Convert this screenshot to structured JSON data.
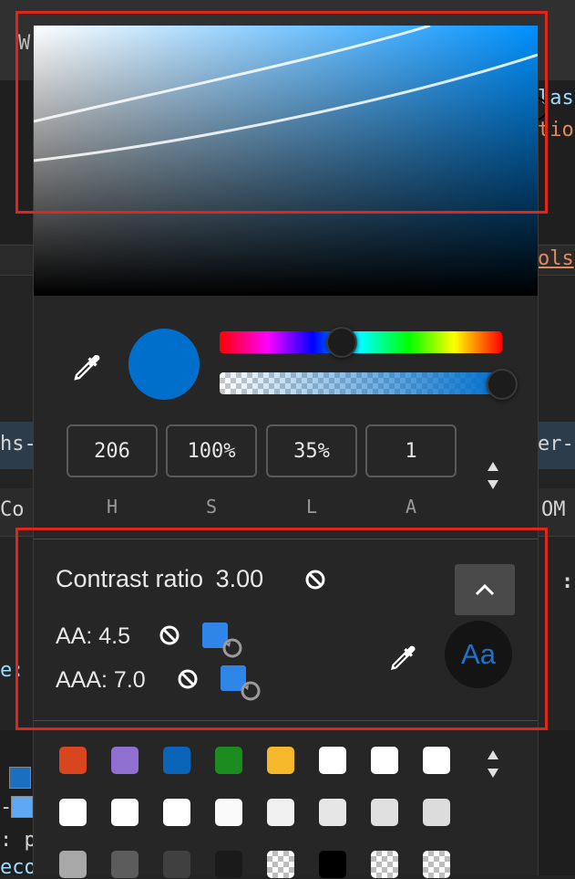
{
  "background": {
    "code_fragments": [
      {
        "id": "w",
        "text": "W"
      },
      {
        "id": "las",
        "text": "las"
      },
      {
        "id": "tio",
        "text": "tio"
      },
      {
        "id": "ols",
        "text": "ols"
      },
      {
        "id": "hs",
        "text": "hs-"
      },
      {
        "id": "erc",
        "text": "er-c"
      },
      {
        "id": "co",
        "text": "Co"
      },
      {
        "id": "om",
        "text": "OM"
      },
      {
        "id": "colon",
        "text": ":"
      },
      {
        "id": "ep",
        "text": "e:"
      },
      {
        "id": "dash",
        "text": "-"
      },
      {
        "id": "p",
        "text": ": p"
      },
      {
        "id": "eco",
        "text": "eco"
      }
    ]
  },
  "color_picker": {
    "current_color": "#006fcc",
    "format_fields": [
      {
        "label": "H",
        "value": "206"
      },
      {
        "label": "S",
        "value": "100%"
      },
      {
        "label": "L",
        "value": "35%"
      },
      {
        "label": "A",
        "value": "1"
      }
    ],
    "hue_degrees": 206,
    "alpha_value": 1,
    "contrast": {
      "title": "Contrast ratio",
      "ratio": "3.00",
      "aa_label": "AA: 4.5",
      "aaa_label": "AAA: 7.0",
      "preview_text": "Aa",
      "preview_color": "#1f72c8"
    },
    "palette": [
      "#d9451f",
      "#8f6fcf",
      "#0a64b8",
      "#1d8c20",
      "#f5b82a",
      "#ffffff",
      "#ffffff",
      "#ffffff",
      "#ffffff",
      "#ffffff",
      "#ffffff",
      "#fafafa",
      "#f0f0f0",
      "#e6e6e6",
      "#e0e0e0",
      "#dcdcdc",
      "#a8a8a8",
      "#5c5c5c",
      "#404040",
      "#1a1a1a",
      "checker",
      "#000000",
      "checker",
      "checker"
    ]
  },
  "colors": {
    "highlight": "#e0251b",
    "panel_bg": "#262626"
  }
}
